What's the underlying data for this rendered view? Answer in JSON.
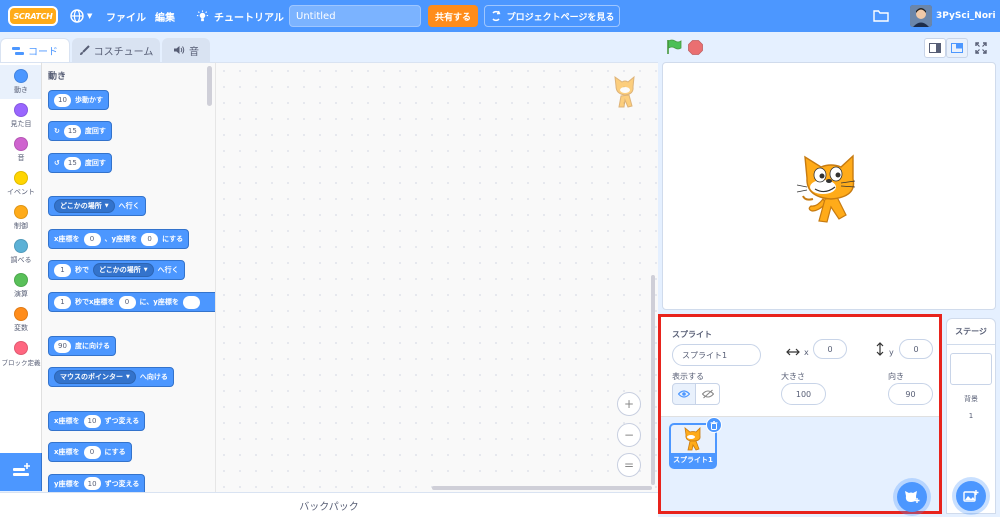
{
  "menubar": {
    "logo_text": "SCRATCH",
    "language_icon": "globe-icon",
    "file_label": "ファイル",
    "edit_label": "編集",
    "tutorial_label": "チュートリアル",
    "project_title": "Untitled",
    "share_label": "共有する",
    "project_page_label": "プロジェクトページを見る",
    "username": "3PySci_Nori",
    "accent_color": "#4c97ff"
  },
  "tabs": {
    "code": "コード",
    "costume": "コスチューム",
    "sound": "音"
  },
  "categories": [
    {
      "label": "動き",
      "color": "#4c97ff"
    },
    {
      "label": "見た目",
      "color": "#9966ff"
    },
    {
      "label": "音",
      "color": "#cf63cf"
    },
    {
      "label": "イベント",
      "color": "#ffd500"
    },
    {
      "label": "制御",
      "color": "#ffab19"
    },
    {
      "label": "調べる",
      "color": "#5cb1d6"
    },
    {
      "label": "演算",
      "color": "#59c059"
    },
    {
      "label": "変数",
      "color": "#ff8c1a"
    },
    {
      "label": "ブロック定義",
      "color": "#ff6680"
    }
  ],
  "palette": {
    "heading": "動き",
    "blocks": {
      "move": {
        "value": "10",
        "text": "歩動かす"
      },
      "turn_right": {
        "value": "15",
        "text": "度回す"
      },
      "turn_left": {
        "value": "15",
        "text": "度回す"
      },
      "goto": {
        "dropdown": "どこかの場所",
        "text": "へ行く"
      },
      "goto_xy": {
        "t1": "x座標を",
        "x": "0",
        "t2": "、y座標を",
        "y": "0",
        "t3": "にする"
      },
      "glide": {
        "value": "1",
        "t1": "秒で",
        "dropdown": "どこかの場所",
        "t2": "へ行く"
      },
      "glide_xy": {
        "value": "1",
        "t1": "秒でx座標を",
        "x": "0",
        "t2": "に、y座標を"
      },
      "point_dir": {
        "value": "90",
        "text": "度に向ける"
      },
      "point_towards": {
        "dropdown": "マウスのポインター",
        "text": "へ向ける"
      },
      "change_x": {
        "t1": "x座標を",
        "value": "10",
        "t2": "ずつ変える"
      },
      "set_x": {
        "t1": "x座標を",
        "value": "0",
        "t2": "にする"
      },
      "change_y": {
        "t1": "y座標を",
        "value": "10",
        "t2": "ずつ変える"
      }
    }
  },
  "zoom": {
    "in": "+",
    "out": "−",
    "reset": "="
  },
  "backpack_label": "バックパック",
  "sprite_info": {
    "sprite_label": "スプライト",
    "sprite_name": "スプライト1",
    "x_label": "x",
    "x_value": "0",
    "y_label": "y",
    "y_value": "0",
    "show_label": "表示する",
    "size_label": "大きさ",
    "size_value": "100",
    "direction_label": "向き",
    "direction_value": "90"
  },
  "sprite_list": {
    "items": [
      {
        "name": "スプライト1"
      }
    ]
  },
  "stage_pane": {
    "title": "ステージ",
    "backdrop_label": "背景",
    "backdrop_count": "1"
  },
  "highlight_color": "#e8231c"
}
